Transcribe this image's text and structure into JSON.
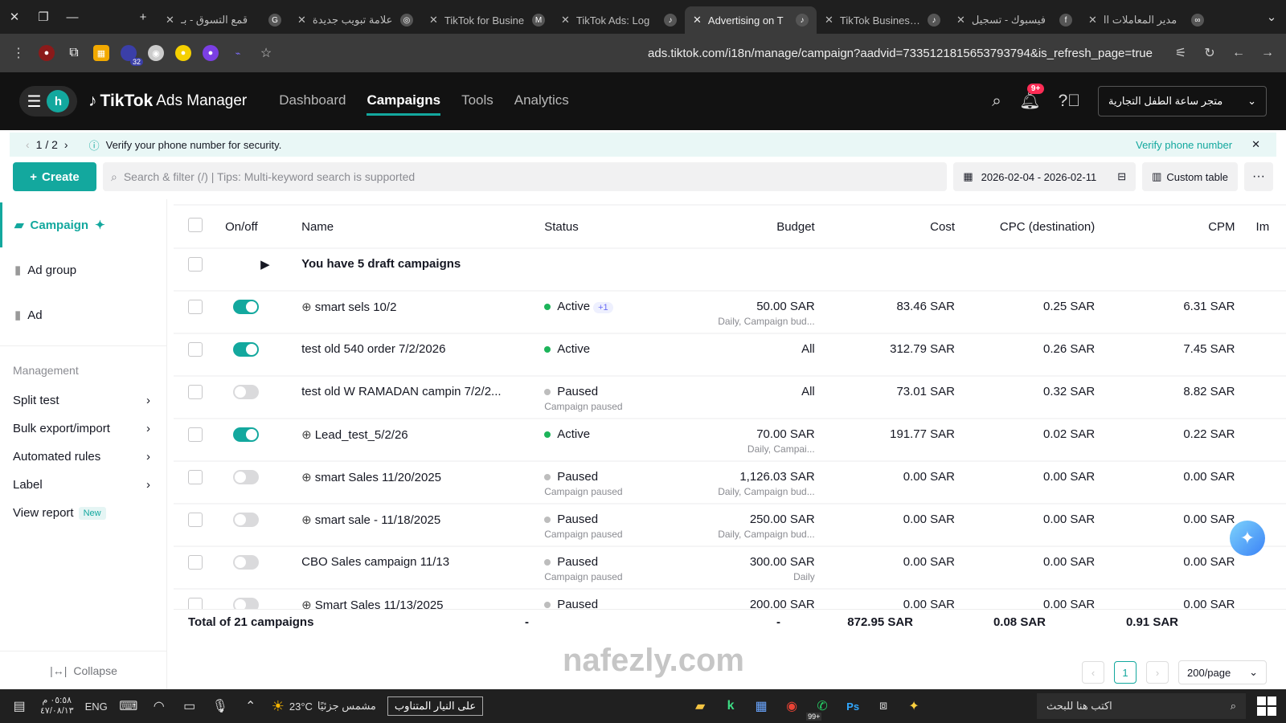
{
  "browser": {
    "tabs": [
      {
        "title": "قمع التسوق - بـ",
        "icon": "G",
        "active": false
      },
      {
        "title": "علامة تبويب جديدة",
        "icon": "◎",
        "active": false
      },
      {
        "title": "TikTok for Busine",
        "icon": "M",
        "active": false
      },
      {
        "title": "TikTok Ads: Log",
        "icon": "♪",
        "active": false
      },
      {
        "title": "Advertising on T",
        "icon": "♪",
        "active": true
      },
      {
        "title": "TikTok Business C",
        "icon": "♪",
        "active": false
      },
      {
        "title": "فيسبوك - تسجيل",
        "icon": "f",
        "active": false
      },
      {
        "title": "مدير المعاملات اا",
        "icon": "∞",
        "active": false
      }
    ],
    "url": "ads.tiktok.com/i18n/manage/campaign?aadvid=7335121815653793794&is_refresh_page=true",
    "ext_badge": "32"
  },
  "nav": {
    "avatar_letter": "h",
    "logo": "TikTok",
    "logo_sub": "Ads Manager",
    "links": [
      "Dashboard",
      "Campaigns",
      "Tools",
      "Analytics"
    ],
    "active_link": "Campaigns",
    "notif_badge": "9+",
    "account": "متجر ساعة الطفل التجارية"
  },
  "notice": {
    "pager": "1 / 2",
    "text": "Verify your phone number for security.",
    "link": "Verify phone number"
  },
  "toolbar": {
    "create": "Create",
    "search_placeholder": "Search & filter (/) | Tips: Multi-keyword search is supported",
    "date_range": "2026-02-04 - 2026-02-11",
    "custom_table": "Custom table"
  },
  "sidebar": {
    "levels": [
      "Campaign",
      "Ad group",
      "Ad"
    ],
    "management_title": "Management",
    "management": [
      "Split test",
      "Bulk export/import",
      "Automated rules",
      "Label"
    ],
    "view_report": "View report",
    "new_badge": "New",
    "collapse": "Collapse"
  },
  "table": {
    "headers": {
      "onoff": "On/off",
      "name": "Name",
      "status": "Status",
      "budget": "Budget",
      "cost": "Cost",
      "cpc": "CPC (destination)",
      "cpm": "CPM",
      "extra": "Im"
    },
    "draft_row": "You have 5 draft campaigns",
    "rows": [
      {
        "on": true,
        "smart": true,
        "name": "smart sels 10/2",
        "status": "Active",
        "status_sub": "",
        "pill": "+1",
        "budget": "50.00 SAR",
        "budget_sub": "Daily, Campaign bud...",
        "cost": "83.46 SAR",
        "cpc": "0.25 SAR",
        "cpm": "6.31 SAR"
      },
      {
        "on": true,
        "smart": false,
        "name": "test old 540 order 7/2/2026",
        "status": "Active",
        "status_sub": "",
        "pill": "",
        "budget": "All",
        "budget_sub": "",
        "cost": "312.79 SAR",
        "cpc": "0.26 SAR",
        "cpm": "7.45 SAR"
      },
      {
        "on": false,
        "smart": false,
        "name": "test old W RAMADAN campin 7/2/2...",
        "status": "Paused",
        "status_sub": "Campaign paused",
        "pill": "",
        "budget": "All",
        "budget_sub": "",
        "cost": "73.01 SAR",
        "cpc": "0.32 SAR",
        "cpm": "8.82 SAR"
      },
      {
        "on": true,
        "smart": true,
        "name": "Lead_test_5/2/26",
        "status": "Active",
        "status_sub": "",
        "pill": "",
        "budget": "70.00 SAR",
        "budget_sub": "Daily, Campai...",
        "cost": "191.77 SAR",
        "cpc": "0.02 SAR",
        "cpm": "0.22 SAR"
      },
      {
        "on": false,
        "smart": true,
        "name": "smart Sales 11/20/2025",
        "status": "Paused",
        "status_sub": "Campaign paused",
        "pill": "",
        "budget": "1,126.03 SAR",
        "budget_sub": "Daily, Campaign bud...",
        "cost": "0.00 SAR",
        "cpc": "0.00 SAR",
        "cpm": "0.00 SAR"
      },
      {
        "on": false,
        "smart": true,
        "name": "smart sale - 11/18/2025",
        "status": "Paused",
        "status_sub": "Campaign paused",
        "pill": "",
        "budget": "250.00 SAR",
        "budget_sub": "Daily, Campaign bud...",
        "cost": "0.00 SAR",
        "cpc": "0.00 SAR",
        "cpm": "0.00 SAR"
      },
      {
        "on": false,
        "smart": false,
        "name": "CBO Sales campaign 11/13",
        "status": "Paused",
        "status_sub": "Campaign paused",
        "pill": "",
        "budget": "300.00 SAR",
        "budget_sub": "Daily",
        "cost": "0.00 SAR",
        "cpc": "0.00 SAR",
        "cpm": "0.00 SAR"
      },
      {
        "on": false,
        "smart": true,
        "name": "Smart Sales 11/13/2025",
        "status": "Paused",
        "status_sub": "",
        "pill": "",
        "budget": "200.00 SAR",
        "budget_sub": "",
        "cost": "0.00 SAR",
        "cpc": "0.00 SAR",
        "cpm": "0.00 SAR"
      }
    ],
    "total": {
      "label": "Total of 21 campaigns",
      "status": "-",
      "budget": "-",
      "cost": "872.95 SAR",
      "cpc": "0.08 SAR",
      "cpm": "0.91 SAR"
    }
  },
  "pagination": {
    "page": "1",
    "per_page": "200/page"
  },
  "watermark": "nafezly.com",
  "taskbar": {
    "time": "٠٥:٥٨ م",
    "date": "٤٧/٠٨/١٣",
    "lang": "ENG",
    "temp": "23°C",
    "weather": "مشمس جزئيًا",
    "news": "على النيار المتناوب",
    "search": "اكتب هنا للبحث",
    "badge": "99+"
  },
  "colors": {
    "accent": "#13a89e",
    "active_dot": "#1db45a",
    "paused_dot": "#bdbdbd"
  }
}
